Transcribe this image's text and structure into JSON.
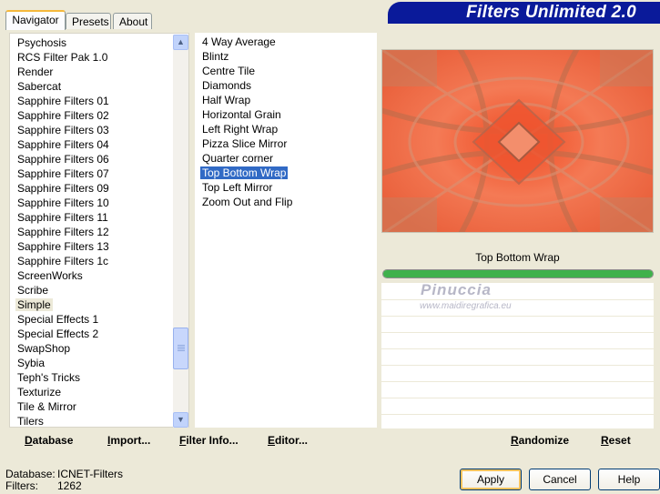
{
  "tabs": [
    {
      "label": "Navigator",
      "active": true
    },
    {
      "label": "Presets",
      "active": false
    },
    {
      "label": "About",
      "active": false
    }
  ],
  "brand": "Filters Unlimited 2.0",
  "categories": {
    "items": [
      "Psychosis",
      "RCS Filter Pak 1.0",
      "Render",
      "Sabercat",
      "Sapphire Filters 01",
      "Sapphire Filters 02",
      "Sapphire Filters 03",
      "Sapphire Filters 04",
      "Sapphire Filters 06",
      "Sapphire Filters 07",
      "Sapphire Filters 09",
      "Sapphire Filters 10",
      "Sapphire Filters 11",
      "Sapphire Filters 12",
      "Sapphire Filters 13",
      "Sapphire Filters 1c",
      "ScreenWorks",
      "Scribe",
      "Simple",
      "Special Effects 1",
      "Special Effects 2",
      "SwapShop",
      "Sybia",
      "Teph's Tricks",
      "Texturize",
      "Tile & Mirror",
      "Tilers"
    ],
    "selected": "Simple"
  },
  "filters": {
    "items": [
      "4 Way Average",
      "Blintz",
      "Centre Tile",
      "Diamonds",
      "Half Wrap",
      "Horizontal Grain",
      "Left Right Wrap",
      "Pizza Slice Mirror",
      "Quarter corner",
      "Top Bottom Wrap",
      "Top Left Mirror",
      "Zoom Out and Flip"
    ],
    "selected": "Top Bottom Wrap"
  },
  "left_buttons": [
    {
      "label": "Database"
    },
    {
      "label": "Import..."
    },
    {
      "label": "Filter Info..."
    },
    {
      "label": "Editor..."
    }
  ],
  "right_buttons": {
    "randomize": "Randomize",
    "reset": "Reset"
  },
  "preview": {
    "filter_name": "Top Bottom Wrap",
    "progress": 1.0
  },
  "watermark": {
    "name": "Pinuccia",
    "url": "www.maidiregrafica.eu"
  },
  "footer": {
    "database_label": "Database:",
    "database_value": "ICNET-Filters",
    "filters_label": "Filters:",
    "filters_value": "1262"
  },
  "dialog_buttons": {
    "apply": "Apply",
    "cancel": "Cancel",
    "help": "Help"
  },
  "colors": {
    "selection": "#316ac5",
    "banner": "#0a1a9a",
    "progress": "#3fb14b"
  }
}
